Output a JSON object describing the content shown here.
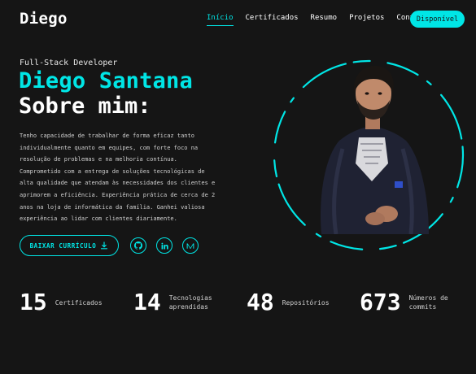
{
  "header": {
    "logo": "Diego",
    "nav": [
      "Início",
      "Certificados",
      "Resumo",
      "Projetos",
      "Contato"
    ],
    "cta_label": "Disponível"
  },
  "hero": {
    "role": "Full-Stack Developer",
    "name": "Diego Santana",
    "subtitle": "Sobre mim:",
    "description": "Tenho capacidade de trabalhar de forma eficaz tanto individualmente quanto em equipes, com forte foco na resolução de problemas e na melhoria contínua. Comprometido com a entrega de soluções tecnológicas de alta qualidade que atendam às necessidades dos clientes e aprimorem a eficiência. Experiência prática de cerca de 2 anos na loja de informática da família. Ganhei valiosa experiência ao lidar com clientes diariamente.",
    "cv_button": "BAIXAR CURRÍCULO",
    "socials": [
      "github-icon",
      "linkedin-icon",
      "medium-icon"
    ]
  },
  "stats": [
    {
      "value": "15",
      "label_1": "Certificados",
      "label_2": ""
    },
    {
      "value": "14",
      "label_1": "Tecnologias",
      "label_2": "aprendidas"
    },
    {
      "value": "48",
      "label_1": "Repositórios",
      "label_2": ""
    },
    {
      "value": "673",
      "label_1": "Números de",
      "label_2": "commits"
    }
  ],
  "colors": {
    "background": "#151515",
    "accent": "#00e6e6",
    "text": "#ffffff"
  }
}
